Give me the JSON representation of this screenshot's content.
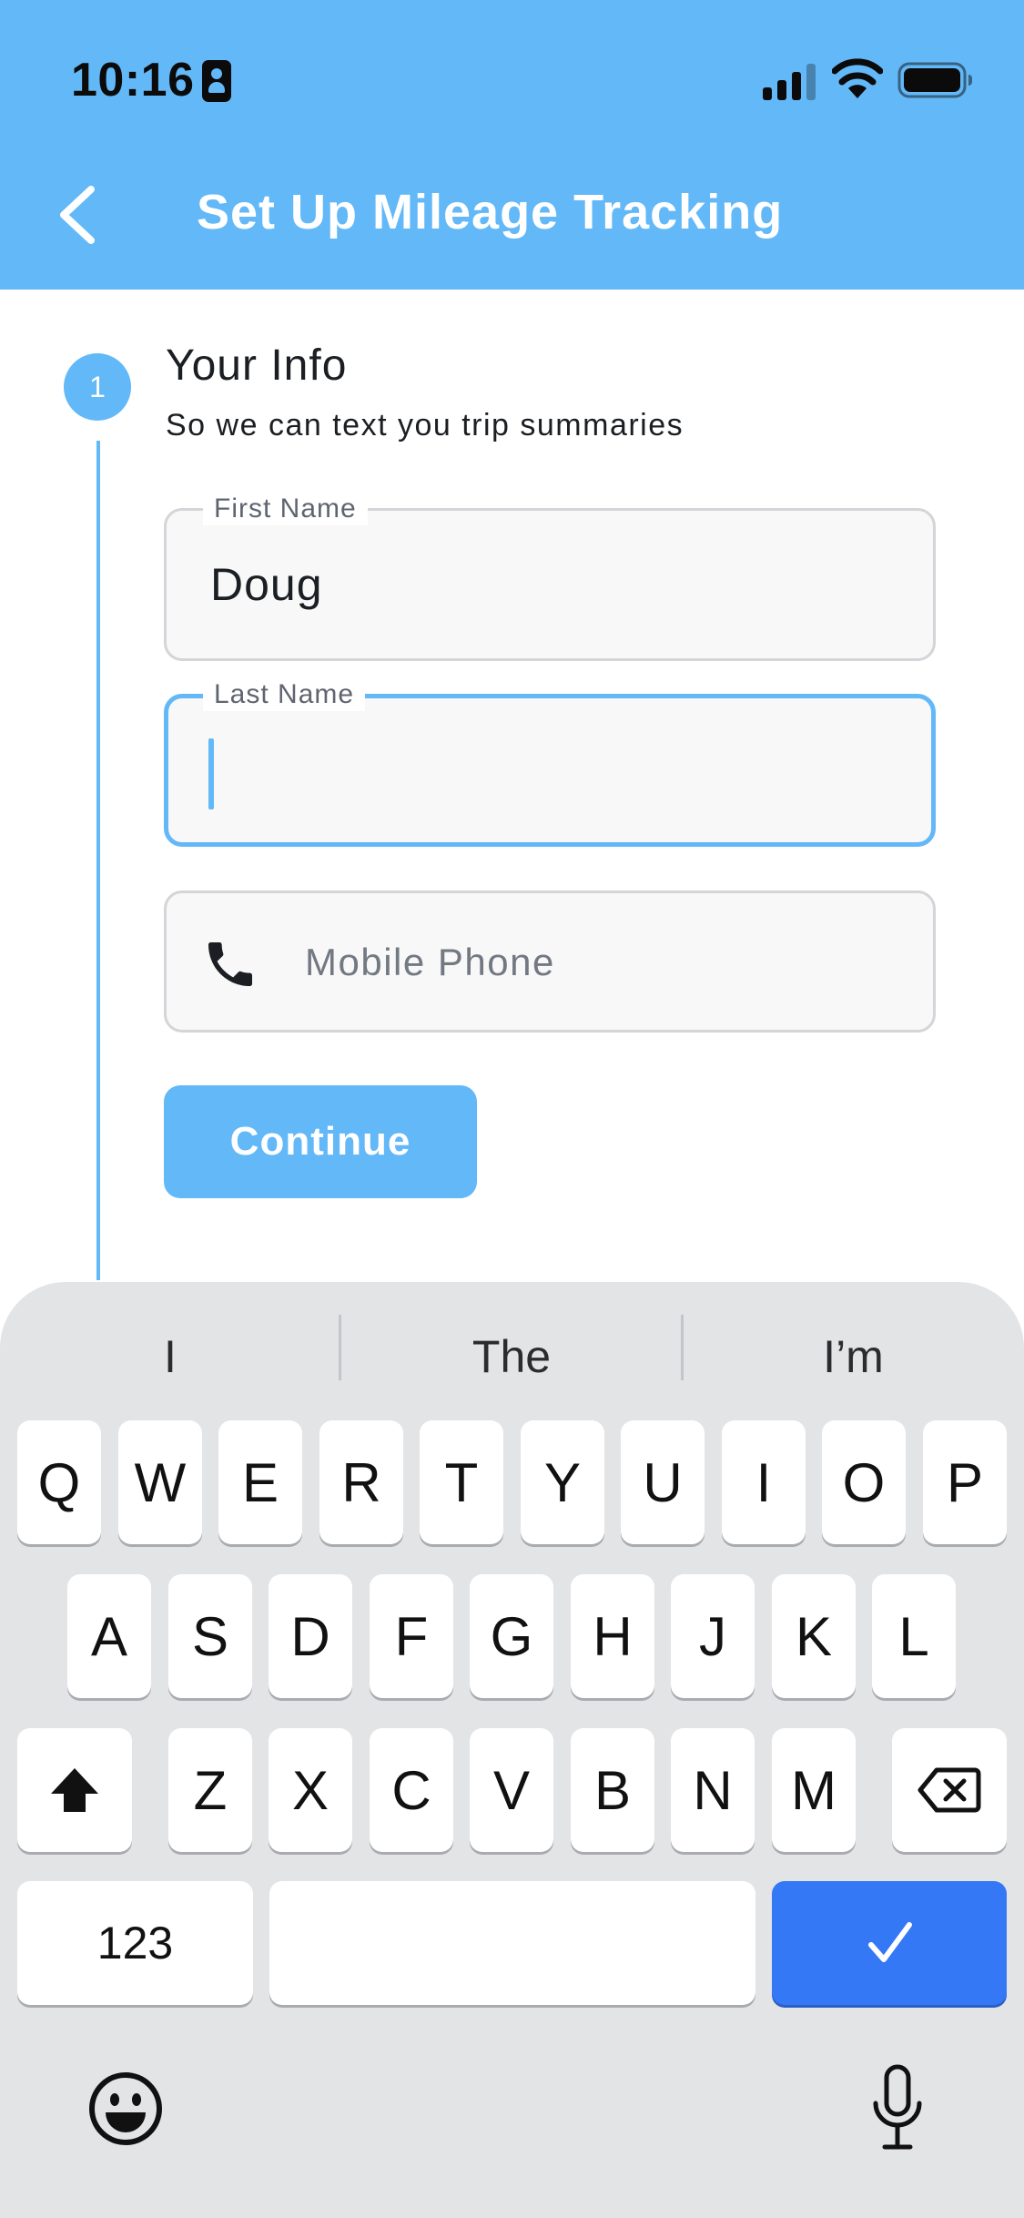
{
  "status_bar": {
    "time": "10:16"
  },
  "header": {
    "title": "Set Up Mileage Tracking",
    "background_color": "#63b8f8"
  },
  "step": {
    "number": "1",
    "title": "Your Info",
    "subtitle": "So we can text you trip summaries"
  },
  "form": {
    "first_name": {
      "label": "First Name",
      "value": "Doug"
    },
    "last_name": {
      "label": "Last Name",
      "value": ""
    },
    "mobile_phone": {
      "placeholder": "Mobile Phone",
      "value": ""
    },
    "continue_label": "Continue"
  },
  "keyboard": {
    "suggestions": [
      "I",
      "The",
      "I’m"
    ],
    "row1": [
      "Q",
      "W",
      "E",
      "R",
      "T",
      "Y",
      "U",
      "I",
      "O",
      "P"
    ],
    "row2": [
      "A",
      "S",
      "D",
      "F",
      "G",
      "H",
      "J",
      "K",
      "L"
    ],
    "row3": [
      "Z",
      "X",
      "C",
      "V",
      "B",
      "N",
      "M"
    ],
    "numbers_label": "123",
    "icons": {
      "shift": "shift-icon",
      "backspace": "backspace-icon",
      "done": "checkmark-icon",
      "emoji": "emoji-icon",
      "dictation": "microphone-icon"
    },
    "done_color": "#3478f6"
  }
}
